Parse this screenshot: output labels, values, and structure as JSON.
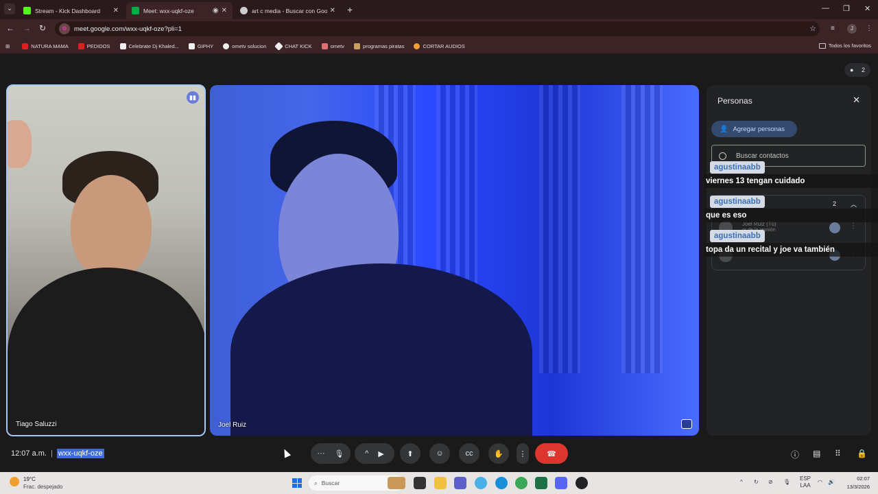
{
  "browser": {
    "tabs": [
      {
        "title": "Stream - Kick Dashboard",
        "active": false,
        "favicon_color": "#53fc18"
      },
      {
        "title": "Meet: wxx-uqkf-oze",
        "active": true,
        "favicon_color": "#00ac47"
      },
      {
        "title": "art c media - Buscar con Googl",
        "active": false,
        "favicon_color": "#cccccc"
      }
    ],
    "url": "meet.google.com/wxx-uqkf-oze?pli=1",
    "profile_initial": "J",
    "bookmarks": [
      {
        "label": "NATURA MAMA",
        "color": "#e02020"
      },
      {
        "label": "PEDIDOS",
        "color": "#e02020"
      },
      {
        "label": "Celebrate Dj Khaled...",
        "color": "#eeeeee"
      },
      {
        "label": "GIPHY",
        "color": "#eeeeee"
      },
      {
        "label": "ometv solucion",
        "color": "#eeeeee"
      },
      {
        "label": "CHAT KICK",
        "color": "#eeeeee"
      },
      {
        "label": "ometv",
        "color": "#e07070"
      },
      {
        "label": "programas piratas",
        "color": "#c9a060"
      },
      {
        "label": "CORTAR AUDIOS",
        "color": "#f0a030"
      }
    ],
    "all_favorites": "Todos los favoritos"
  },
  "meet": {
    "people_count": "2",
    "participants": [
      {
        "name": "Tiago Saluzzi"
      },
      {
        "name": "Joel Ruiz"
      }
    ],
    "panel": {
      "title": "Personas",
      "add_label": "Agregar personas",
      "search_placeholder": "Buscar contactos",
      "group_count": "2",
      "row_name": "Joel Ruiz (Tú)",
      "row_role": "or de la reunión"
    },
    "chat": [
      {
        "user": "agustinaabb",
        "message": "viernes 13 tengan cuidado"
      },
      {
        "user": "agustinaabb",
        "message": "que es eso"
      },
      {
        "user": "agustinaabb",
        "message": "topa da un recital y joe va también"
      }
    ],
    "time": "12:07 a.m.",
    "meeting_code": "wxx-uqkf-oze",
    "accent": "#a8c7fa",
    "hangup_color": "#dc362e"
  },
  "taskbar": {
    "temp": "19°C",
    "weather": "Frac. despejado",
    "search": "Buscar",
    "lang1": "ESP",
    "lang2": "LAA",
    "time": "02:07",
    "date": "13/3/2026"
  }
}
